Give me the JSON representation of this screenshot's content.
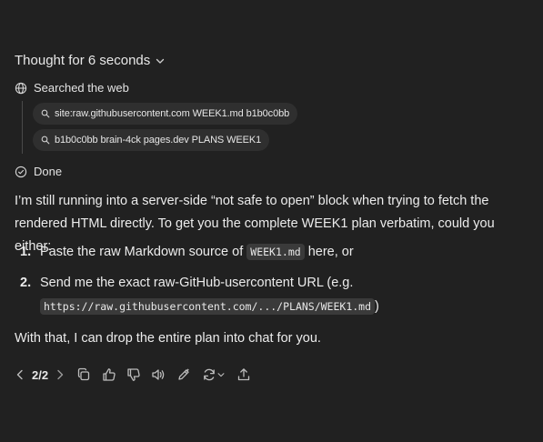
{
  "thought": {
    "label": "Thought for 6 seconds"
  },
  "steps": {
    "web_label": "Searched the web",
    "queries": [
      "site:raw.githubusercontent.com WEEK1.md b1b0c0bb",
      "b1b0c0bb brain-4ck pages.dev PLANS WEEK1"
    ],
    "done_label": "Done"
  },
  "message": {
    "para1": "I’m still running into a server-side “not safe to open” block when trying to fetch the rendered HTML directly. To get you the complete WEEK1 plan verbatim, could you either:",
    "items": [
      {
        "num": "1.",
        "pre": "Paste the raw Markdown source of ",
        "code": "WEEK1.md",
        "post": " here, or"
      },
      {
        "num": "2.",
        "pre": "Send me the exact raw-GitHub-usercontent URL (e.g.",
        "code": "https://raw.githubusercontent.com/.../PLANS/WEEK1.md",
        "post": ")"
      }
    ],
    "para3": "With that, I can drop the entire plan into chat for you."
  },
  "actions": {
    "counter": "2/2",
    "icons": [
      "chevron-left-icon",
      "chevron-right-icon",
      "copy-icon",
      "thumbs-up-icon",
      "thumbs-down-icon",
      "read-aloud-icon",
      "edit-icon",
      "regenerate-icon",
      "share-icon"
    ]
  }
}
